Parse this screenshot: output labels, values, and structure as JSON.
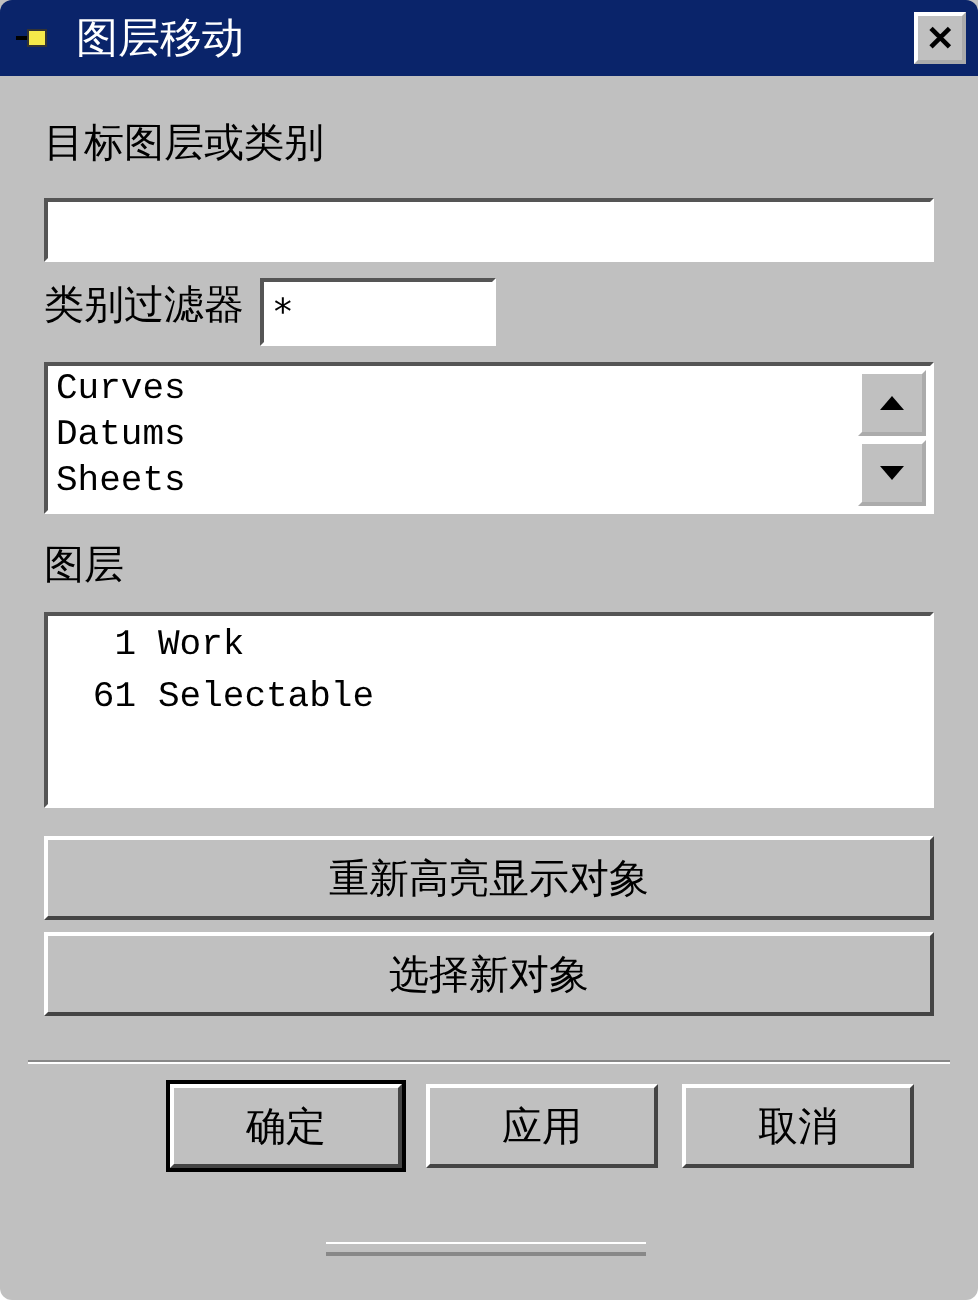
{
  "window": {
    "title": "图层移动",
    "close": "✕"
  },
  "target": {
    "label": "目标图层或类别"
  },
  "filter": {
    "label": "类别过滤器",
    "value": "*"
  },
  "categories": [
    "Curves",
    "Datums",
    "Sheets"
  ],
  "layers_label": "图层",
  "layers": [
    {
      "number": "1",
      "name": "Work"
    },
    {
      "number": "61",
      "name": "Selectable"
    }
  ],
  "actions": [
    "重新高亮显示对象",
    "选择新对象"
  ],
  "buttons": [
    {
      "label": "确定",
      "default": true
    },
    {
      "label": "应用",
      "default": false
    },
    {
      "label": "取消",
      "default": false
    }
  ]
}
